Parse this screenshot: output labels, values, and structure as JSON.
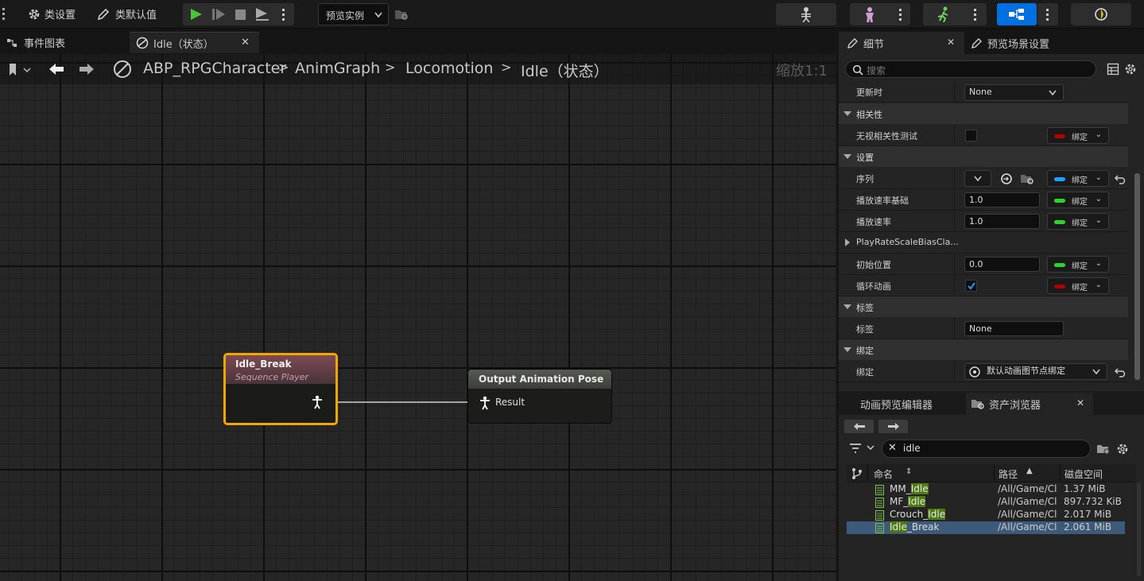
{
  "toolbar": {
    "class_settings": "类设置",
    "class_defaults": "类默认值",
    "preview_instance": "预览实例"
  },
  "tabs": {
    "event_graph": "事件图表",
    "idle_state": "Idle（状态）"
  },
  "breadcrumb": {
    "root": "ABP_RPGCharacter",
    "items": [
      "AnimGraph",
      "Locomotion",
      "Idle（状态）"
    ],
    "zoom": "缩放1:1"
  },
  "nodes": {
    "idle_break": {
      "title": "Idle_Break",
      "subtitle": "Sequence Player"
    },
    "output_pose": {
      "title": "Output Animation Pose",
      "pin": "Result"
    }
  },
  "details": {
    "tab_details": "细节",
    "tab_preview": "预览场景设置",
    "search_placeholder": "搜索",
    "update_label": "更新时",
    "update_value": "None",
    "cat_relevance": "相关性",
    "ignore_relevance": "无视相关性测试",
    "cat_settings": "设置",
    "sequence": "序列",
    "play_rate_basis": "播放速率基础",
    "play_rate_basis_value": "1.0",
    "play_rate": "播放速率",
    "play_rate_value": "1.0",
    "scale_bias": "PlayRateScaleBiasCla...",
    "start_position": "初始位置",
    "start_position_value": "0.0",
    "loop": "循环动画",
    "cat_tag": "标签",
    "tag": "标签",
    "tag_value": "None",
    "cat_binding": "绑定",
    "binding": "绑定",
    "binding_value": "默认动画图节点绑定",
    "bind_label": "绑定",
    "colors": {
      "red": "#b00000",
      "green": "#2ed32e",
      "blue": "#1aa0ff"
    }
  },
  "assets": {
    "tab_anim_editor": "动画预览编辑器",
    "tab_asset_browser": "资产浏览器",
    "search_value": "idle",
    "col_name": "命名",
    "col_path": "路径",
    "col_size": "磁盘空间",
    "rows": [
      {
        "pre": "MM_",
        "hl": "Idle",
        "post": "",
        "path": "/All/Game/Cl",
        "size": "1.37 MiB"
      },
      {
        "pre": "MF_",
        "hl": "Idle",
        "post": "",
        "path": "/All/Game/Cl",
        "size": "897.732 KiB"
      },
      {
        "pre": "Crouch_",
        "hl": "Idle",
        "post": "",
        "path": "/All/Game/Cl",
        "size": "2.017 MiB"
      },
      {
        "pre": "",
        "hl": "Idle",
        "post": "_Break",
        "path": "/All/Game/Cl",
        "size": "2.061 MiB"
      }
    ]
  }
}
